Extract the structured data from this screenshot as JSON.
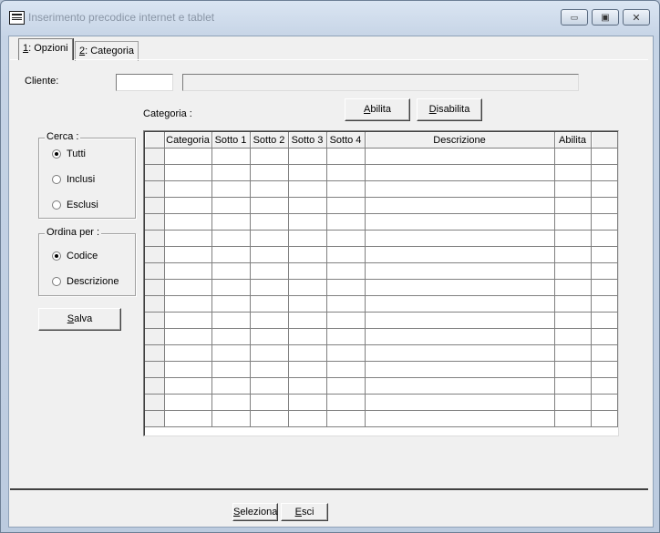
{
  "window": {
    "title": "Inserimento precodice internet e tablet",
    "minimize": "▭",
    "maximize": "▣",
    "close": "✕"
  },
  "tabs": [
    {
      "key": "1",
      "label": ": Opzioni"
    },
    {
      "key": "2",
      "label": ": Categoria"
    }
  ],
  "cliente": {
    "label": "Cliente:",
    "code_value": "",
    "name_value": ""
  },
  "categoria_label": "Categoria :",
  "buttons": {
    "abilita": {
      "key": "A",
      "rest": "bilita"
    },
    "disabilita": {
      "key": "D",
      "rest": "isabilita"
    },
    "salva": {
      "key": "S",
      "rest": "alva"
    },
    "seleziona": {
      "key": "S",
      "rest": "eleziona"
    },
    "esci": {
      "key": "E",
      "rest": "sci"
    }
  },
  "cerca": {
    "title": "Cerca :",
    "options": [
      "Tutti",
      "Inclusi",
      "Esclusi"
    ],
    "selected": "Tutti"
  },
  "ordina": {
    "title": "Ordina per :",
    "options": [
      "Codice",
      "Descrizione"
    ],
    "selected": "Codice"
  },
  "grid": {
    "columns": [
      "",
      "Categoria",
      "Sotto 1",
      "Sotto 2",
      "Sotto 3",
      "Sotto 4",
      "Descrizione",
      "Abilita",
      ""
    ],
    "row_count": 17
  },
  "colors": {
    "titlebar": "#c6d4e6",
    "dialog_face": "#f0f0f0",
    "grid_line": "#808080"
  }
}
